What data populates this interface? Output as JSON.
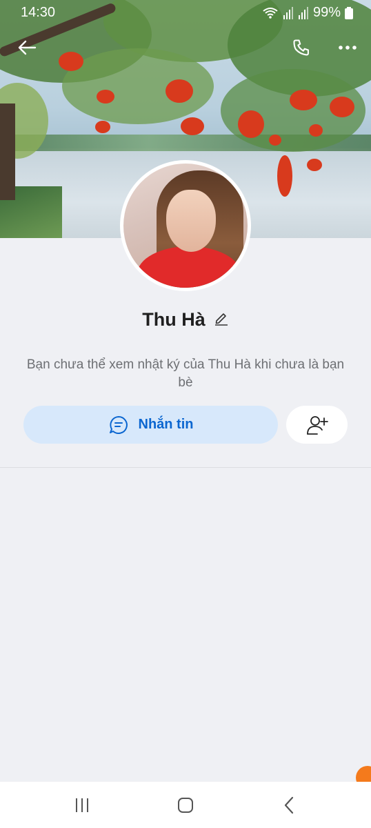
{
  "status_bar": {
    "time": "14:30",
    "battery": "99%"
  },
  "profile": {
    "name": "Thu Hà",
    "info_text": "Bạn chưa thể xem nhật ký của Thu Hà khi chưa là bạn bè"
  },
  "actions": {
    "message_label": "Nhắn tin"
  },
  "colors": {
    "accent": "#0b66d0",
    "message_button_bg": "#d7e8fb",
    "page_bg": "#eff0f4"
  }
}
